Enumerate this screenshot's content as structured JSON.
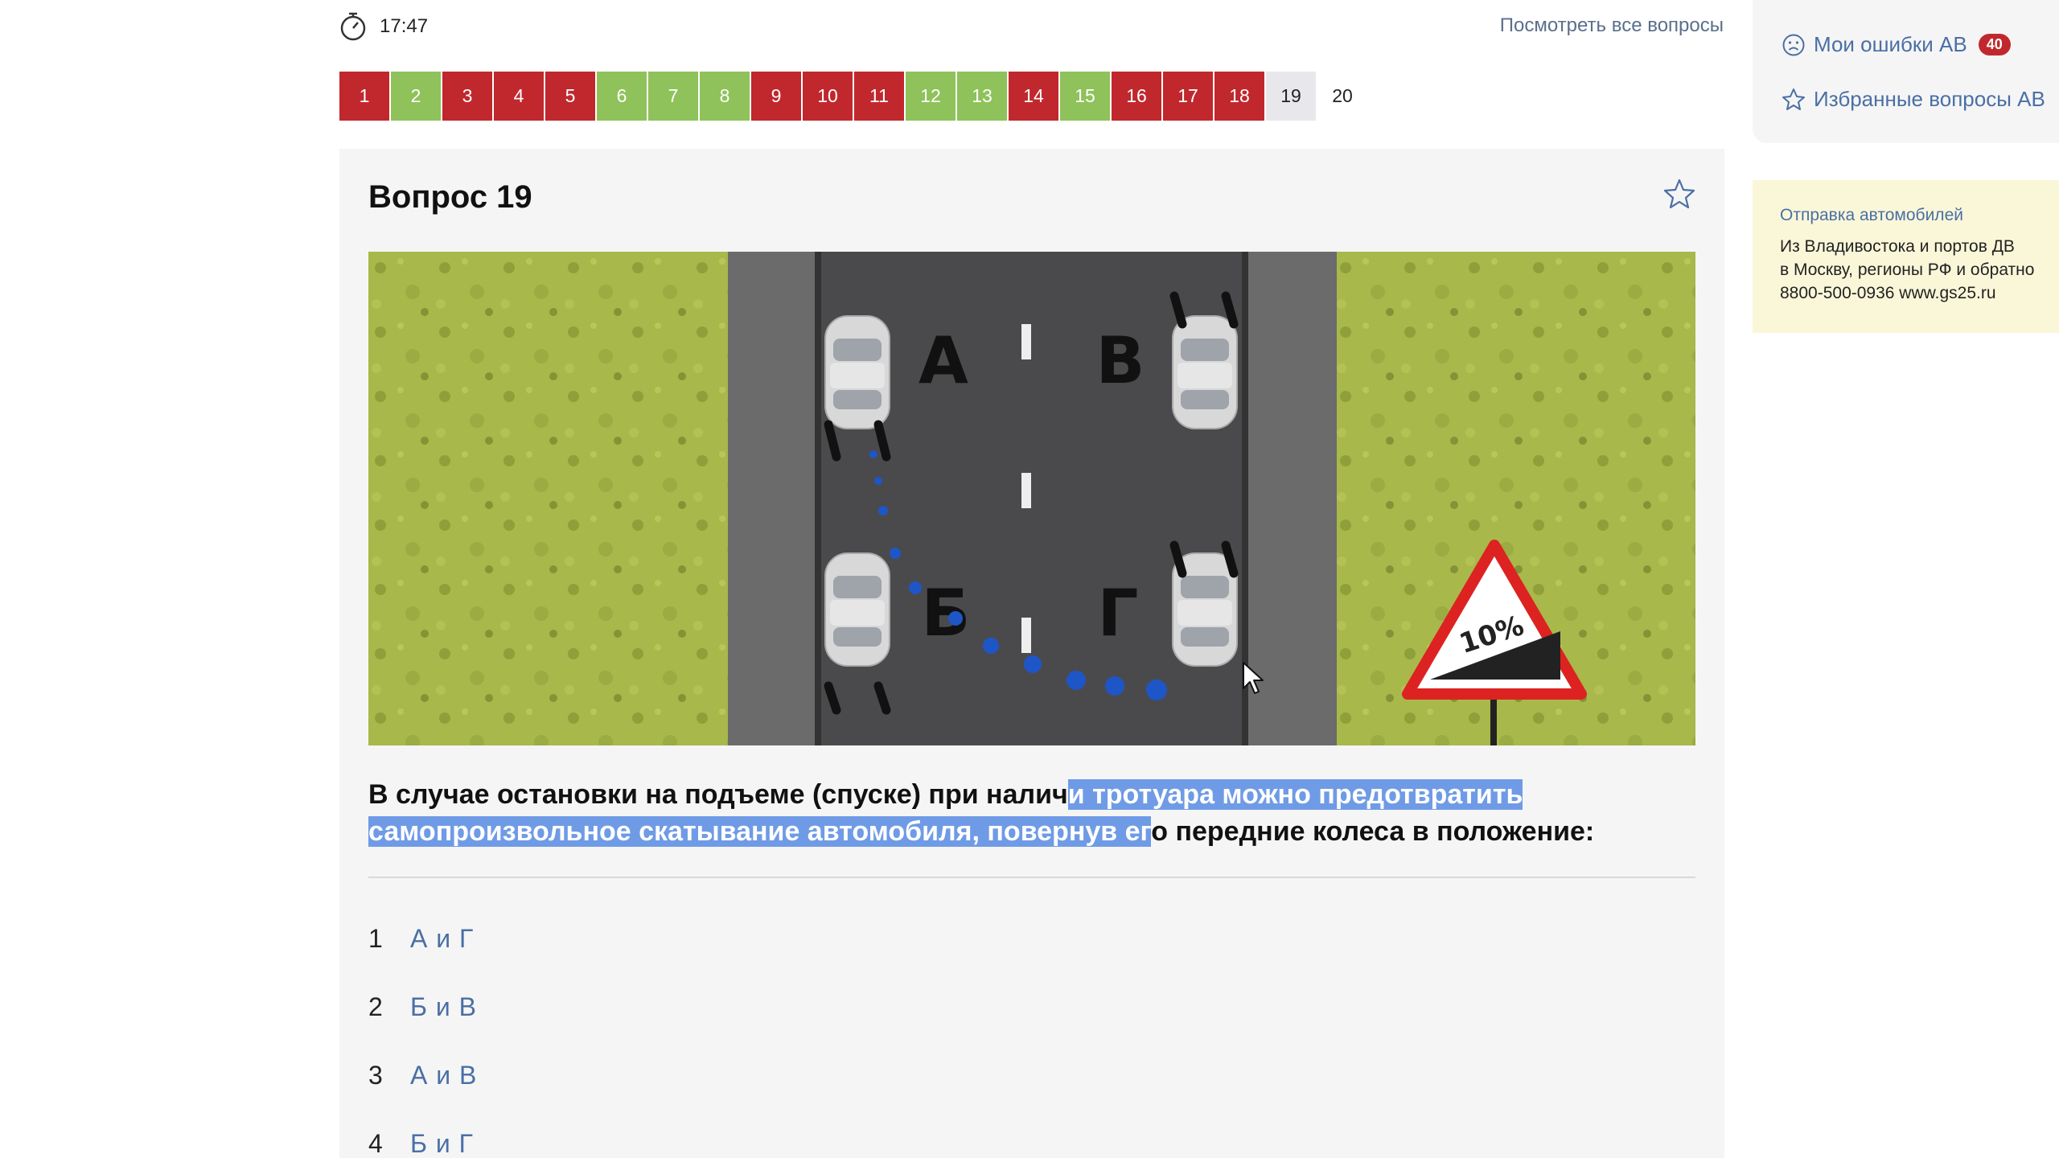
{
  "timer": {
    "icon": "stopwatch-icon",
    "value": "17:47"
  },
  "header": {
    "all_questions_link": "Посмотреть все вопросы"
  },
  "question_nav": [
    {
      "label": "1",
      "status": "wrong"
    },
    {
      "label": "2",
      "status": "right"
    },
    {
      "label": "3",
      "status": "wrong"
    },
    {
      "label": "4",
      "status": "wrong"
    },
    {
      "label": "5",
      "status": "wrong"
    },
    {
      "label": "6",
      "status": "right"
    },
    {
      "label": "7",
      "status": "right"
    },
    {
      "label": "8",
      "status": "right"
    },
    {
      "label": "9",
      "status": "wrong"
    },
    {
      "label": "10",
      "status": "wrong"
    },
    {
      "label": "11",
      "status": "wrong"
    },
    {
      "label": "12",
      "status": "right"
    },
    {
      "label": "13",
      "status": "right"
    },
    {
      "label": "14",
      "status": "wrong"
    },
    {
      "label": "15",
      "status": "right"
    },
    {
      "label": "16",
      "status": "wrong"
    },
    {
      "label": "17",
      "status": "wrong"
    },
    {
      "label": "18",
      "status": "wrong"
    },
    {
      "label": "19",
      "status": "current"
    },
    {
      "label": "20",
      "status": "pending"
    }
  ],
  "question": {
    "title": "Вопрос 19",
    "favorite_icon": "star-icon",
    "image": {
      "labels": {
        "a": "А",
        "b": "Б",
        "v": "В",
        "g": "Г"
      },
      "sign_text": "10%"
    },
    "text_before": "В случае остановки на подъеме (спуске) при налич",
    "text_highlighted": "и тротуара можно предотвратить самопроизвольное скатывание автомобиля, повернув ег",
    "text_after": "о передние колеса в положение:"
  },
  "answers": [
    {
      "num": "1",
      "text": "А и Г"
    },
    {
      "num": "2",
      "text": "Б и В"
    },
    {
      "num": "3",
      "text": "А и В"
    },
    {
      "num": "4",
      "text": "Б и Г"
    }
  ],
  "sidebar": {
    "my_mistakes": {
      "label": "Мои ошибки АВ",
      "count": "40",
      "icon": "sad-face-icon"
    },
    "favorites": {
      "label": "Избранные вопросы АВ",
      "icon": "star-icon"
    }
  },
  "ad": {
    "title": "Отправка автомобилей",
    "line1": "Из Владивостока и портов ДВ",
    "line2": "в Москву, регионы РФ и обратно",
    "line3": "8800-500-0936 www.gs25.ru"
  },
  "colors": {
    "wrong": "#c0282d",
    "right": "#8fc25a",
    "link": "#4a6fa5",
    "highlight": "#6f9be6"
  }
}
